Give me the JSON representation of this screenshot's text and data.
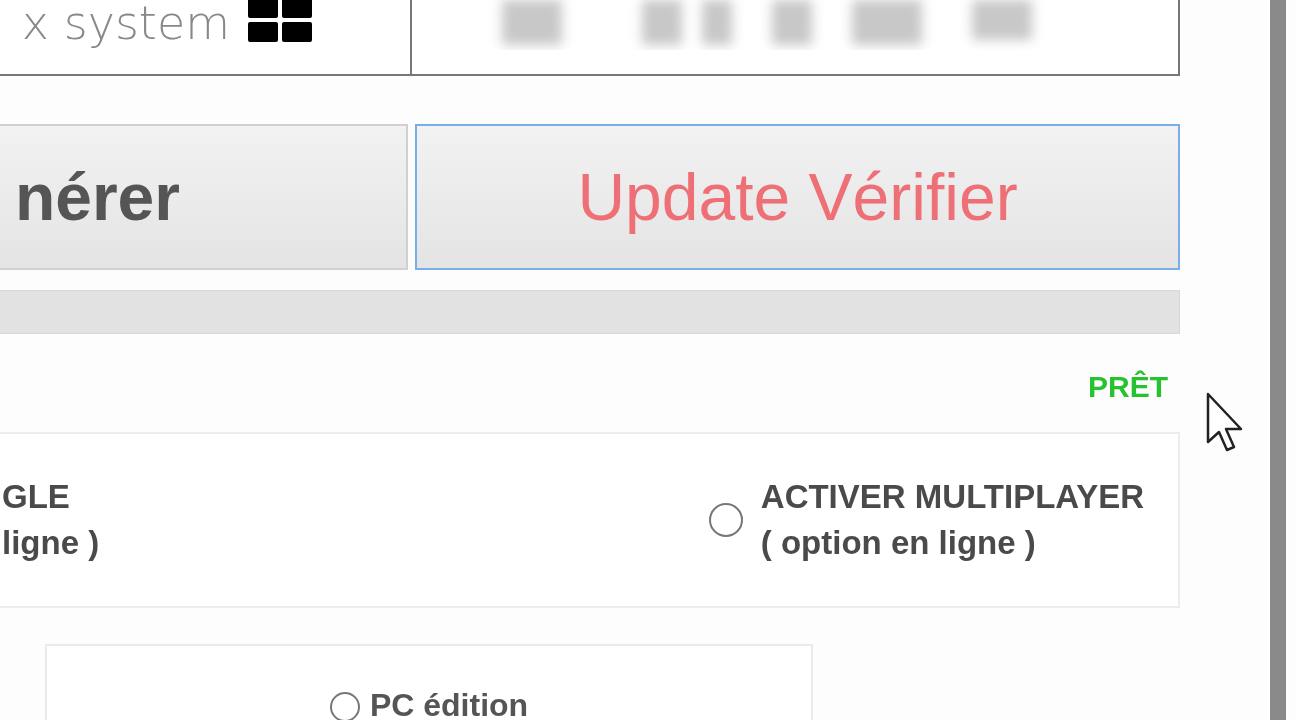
{
  "header": {
    "system_label": "x system"
  },
  "buttons": [
    {
      "label": "nérer",
      "focused": false
    },
    {
      "label": "Update Vérifier",
      "focused": true
    }
  ],
  "status": "PRÊT",
  "modes": [
    {
      "kind": "partial",
      "lines": [
        "GLE",
        "ligne )"
      ]
    },
    {
      "kind": "radio",
      "lines": [
        "ACTIVER MULTIPLAYER",
        "( option en ligne )"
      ],
      "selected": false
    }
  ],
  "edition": {
    "label": "PC édition",
    "selected": false
  }
}
